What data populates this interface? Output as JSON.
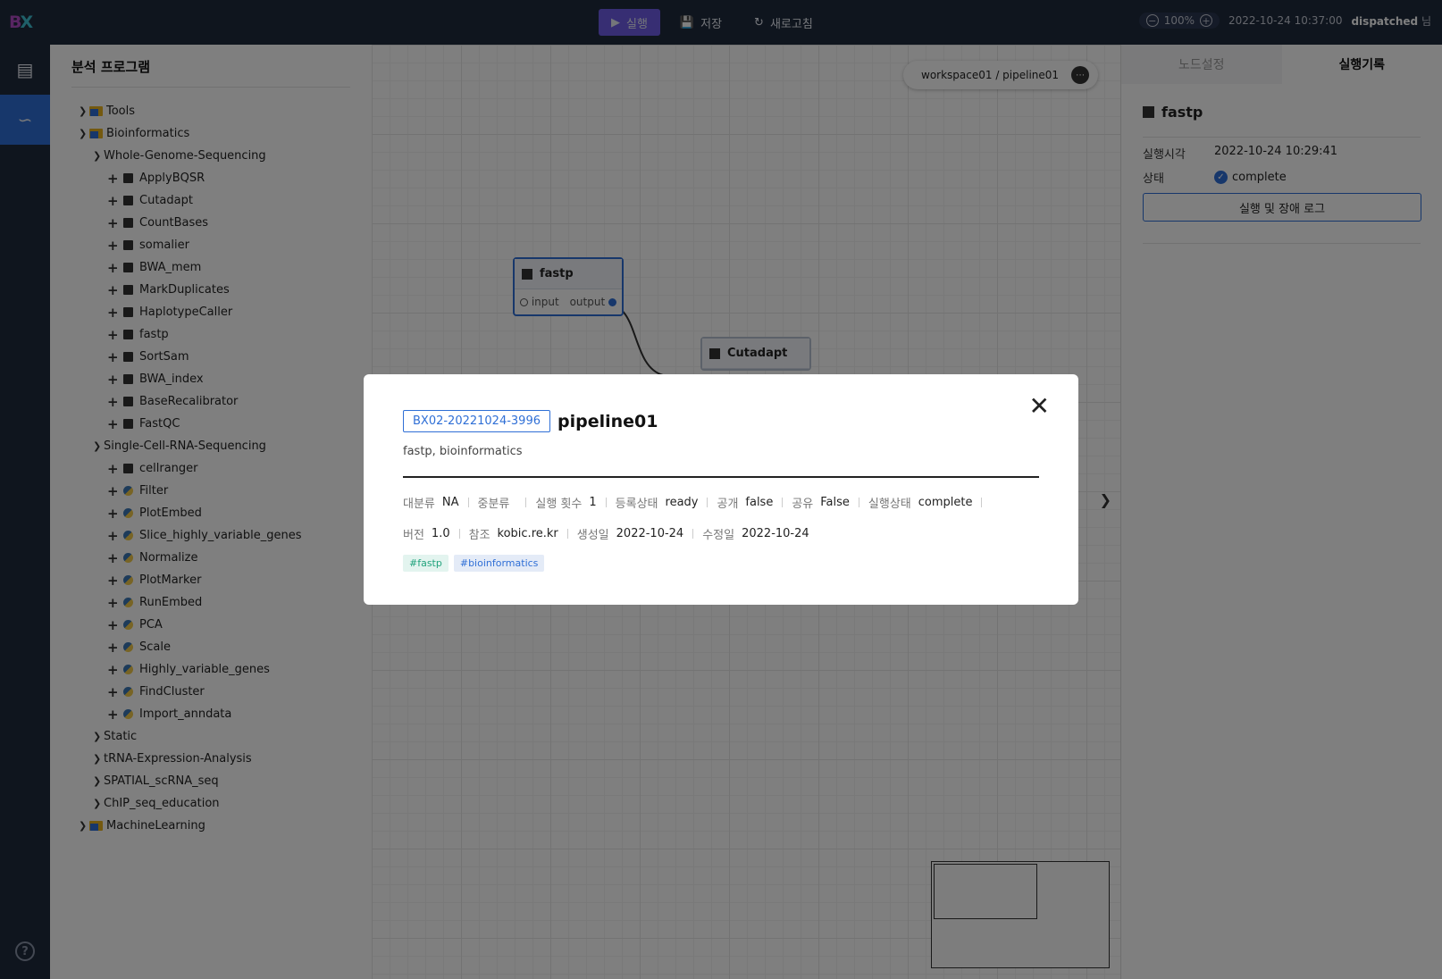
{
  "topbar": {
    "logo": "BX",
    "actions": [
      {
        "label": "실행",
        "icon": "play-icon",
        "primary": true
      },
      {
        "label": "저장",
        "icon": "save-icon",
        "primary": false
      },
      {
        "label": "새로고침",
        "icon": "refresh-icon",
        "primary": false
      }
    ],
    "zoom": "100%",
    "datetime": "2022-10-24 10:37:00",
    "user": "dispatched",
    "user_suffix": "님"
  },
  "rail": {
    "items": [
      {
        "icon": "document-icon",
        "active": false
      },
      {
        "icon": "chart-icon",
        "active": true
      }
    ],
    "help": "?"
  },
  "tree": {
    "title": "분석 프로그램",
    "rows": [
      {
        "level": 1,
        "kind": "folder",
        "label": "Tools"
      },
      {
        "level": 1,
        "kind": "folder",
        "label": "Bioinformatics"
      },
      {
        "level": 2,
        "kind": "group",
        "label": "Whole-Genome-Sequencing"
      },
      {
        "level": 3,
        "kind": "tool",
        "label": "ApplyBQSR"
      },
      {
        "level": 3,
        "kind": "tool",
        "label": "Cutadapt"
      },
      {
        "level": 3,
        "kind": "tool",
        "label": "CountBases"
      },
      {
        "level": 3,
        "kind": "tool",
        "label": "somalier"
      },
      {
        "level": 3,
        "kind": "tool",
        "label": "BWA_mem"
      },
      {
        "level": 3,
        "kind": "tool",
        "label": "MarkDuplicates"
      },
      {
        "level": 3,
        "kind": "tool",
        "label": "HaplotypeCaller"
      },
      {
        "level": 3,
        "kind": "tool",
        "label": "fastp"
      },
      {
        "level": 3,
        "kind": "tool",
        "label": "SortSam"
      },
      {
        "level": 3,
        "kind": "tool",
        "label": "BWA_index"
      },
      {
        "level": 3,
        "kind": "tool",
        "label": "BaseRecalibrator"
      },
      {
        "level": 3,
        "kind": "tool",
        "label": "FastQC"
      },
      {
        "level": 2,
        "kind": "group",
        "label": "Single-Cell-RNA-Sequencing"
      },
      {
        "level": 3,
        "kind": "tool",
        "label": "cellranger"
      },
      {
        "level": 3,
        "kind": "python",
        "label": "Filter"
      },
      {
        "level": 3,
        "kind": "python",
        "label": "PlotEmbed"
      },
      {
        "level": 3,
        "kind": "python",
        "label": "Slice_highly_variable_genes"
      },
      {
        "level": 3,
        "kind": "python",
        "label": "Normalize"
      },
      {
        "level": 3,
        "kind": "python",
        "label": "PlotMarker"
      },
      {
        "level": 3,
        "kind": "python",
        "label": "RunEmbed"
      },
      {
        "level": 3,
        "kind": "python",
        "label": "PCA"
      },
      {
        "level": 3,
        "kind": "python",
        "label": "Scale"
      },
      {
        "level": 3,
        "kind": "python",
        "label": "Highly_variable_genes"
      },
      {
        "level": 3,
        "kind": "python",
        "label": "FindCluster"
      },
      {
        "level": 3,
        "kind": "python",
        "label": "Import_anndata"
      },
      {
        "level": 2,
        "kind": "group",
        "label": "Static"
      },
      {
        "level": 2,
        "kind": "group",
        "label": "tRNA-Expression-Analysis"
      },
      {
        "level": 2,
        "kind": "group",
        "label": "SPATIAL_scRNA_seq"
      },
      {
        "level": 2,
        "kind": "group",
        "label": "ChIP_seq_education"
      },
      {
        "level": 1,
        "kind": "folder",
        "label": "MachineLearning"
      }
    ]
  },
  "canvas": {
    "breadcrumb": "workspace01 / pipeline01",
    "nodes": [
      {
        "title": "fastp",
        "input": "input",
        "output": "output"
      },
      {
        "title": "Cutadapt"
      }
    ]
  },
  "right_panel": {
    "tabs": [
      {
        "label": "노드설정",
        "active": false
      },
      {
        "label": "실행기록",
        "active": true
      }
    ],
    "title": "fastp",
    "run_time_label": "실행시각",
    "run_time": "2022-10-24 10:29:41",
    "status_label": "상태",
    "status": "complete",
    "log_button": "실행 및 장애 로그"
  },
  "modal": {
    "id": "BX02-20221024-3996",
    "name": "pipeline01",
    "description": "fastp, bioinformatics",
    "meta_row1": [
      {
        "k": "대분류",
        "v": "NA"
      },
      {
        "k": "중분류",
        "v": ""
      },
      {
        "k": "실행 횟수",
        "v": "1"
      },
      {
        "k": "등록상태",
        "v": "ready"
      },
      {
        "k": "공개",
        "v": "false"
      },
      {
        "k": "공유",
        "v": "False"
      },
      {
        "k": "실행상태",
        "v": "complete"
      }
    ],
    "meta_row2": [
      {
        "k": "버전",
        "v": "1.0"
      },
      {
        "k": "참조",
        "v": "kobic.re.kr"
      },
      {
        "k": "생성일",
        "v": "2022-10-24"
      },
      {
        "k": "수정일",
        "v": "2022-10-24"
      }
    ],
    "tags": [
      "#fastp",
      "#bioinformatics"
    ],
    "colors": {
      "accent": "#2f6fd6",
      "tag_green": "#21a37d"
    }
  }
}
